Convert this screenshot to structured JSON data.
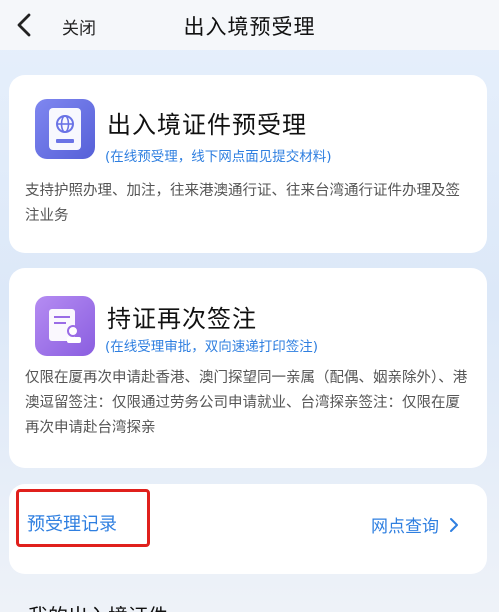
{
  "nav": {
    "close_label": "关闭",
    "title": "出入境预受理"
  },
  "cards": [
    {
      "icon": "passport-icon",
      "title": "出入境证件预受理",
      "subtitle": "(在线预受理，线下网点面见提交材料)",
      "description": "支持护照办理、加注，往来港澳通行证、往来台湾通行证件办理及签注业务"
    },
    {
      "icon": "certificate-renew-icon",
      "title": "持证再次签注",
      "subtitle": "(在线受理审批，双向速递打印签注)",
      "description": "仅限在厦再次申请赴香港、澳门探望同一亲属（配偶、姻亲除外）、港澳逗留签注：仅限通过劳务公司申请就业、台湾探亲签注：仅限在厦再次申请赴台湾探亲"
    }
  ],
  "footer": {
    "record_label": "预受理记录",
    "outlet_label": "网点查询"
  },
  "next_section": {
    "title": "我的出入境证件"
  },
  "colors": {
    "accent": "#2f7fe0",
    "highlight": "#e0201c"
  }
}
